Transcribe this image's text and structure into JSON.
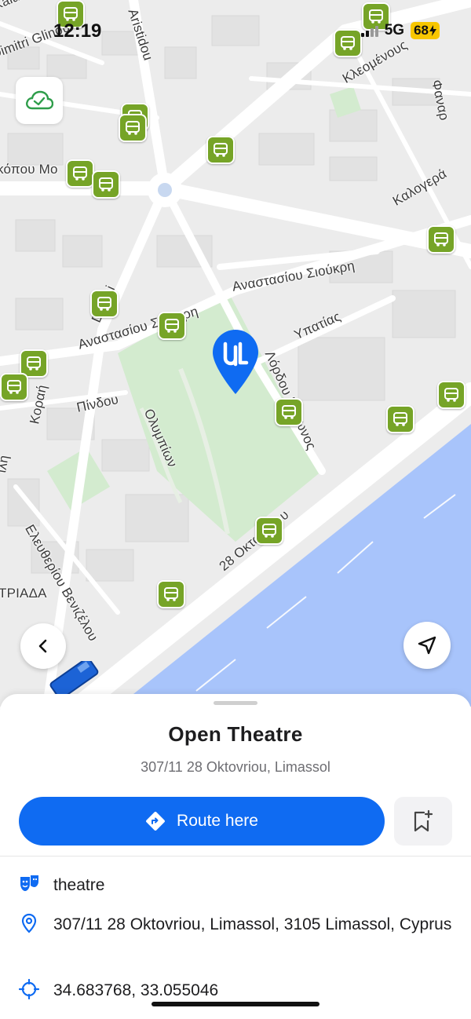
{
  "status_bar": {
    "time": "12:19",
    "network": "5G",
    "battery": "68"
  },
  "map": {
    "street_labels": [
      {
        "text": "Kalama"
      },
      {
        "text": "Dimitri Glinou"
      },
      {
        "text": "Aristidou"
      },
      {
        "text": "Κλεομένους"
      },
      {
        "text": "Φαναρ"
      },
      {
        "text": "κόπου Μο"
      },
      {
        "text": "Καλογερά"
      },
      {
        "text": "Αναστασίου Σιούκρη"
      },
      {
        "text": "Digeni"
      },
      {
        "text": "Αναστασίου Σιούκρη"
      },
      {
        "text": "Υπατίας"
      },
      {
        "text": "Λόρδου Βύρωνος"
      },
      {
        "text": "Κοραή"
      },
      {
        "text": "Πίνδου"
      },
      {
        "text": "Ολυμπίων"
      },
      {
        "text": "28 Οκτωβρίου"
      },
      {
        "text": "Ελευθερίου Βενιζέλου"
      },
      {
        "text": "ΤΡΙΑΔΑ"
      },
      {
        "text": "ίλη"
      }
    ],
    "bus_stop_icon": "bus-stop-icon"
  },
  "colors": {
    "accent": "#0f6bf2",
    "bus_stop": "#76a427",
    "sea": "#a8c4fb",
    "park": "#d3ebcf"
  },
  "place": {
    "name": "Open Theatre",
    "short_address": "307/11 28 Oktovriou, Limassol",
    "route_label": "Route here",
    "category": "theatre",
    "full_address": "307/11 28 Oktovriou, Limassol, 3105 Limassol, Cyprus",
    "coordinates": "34.683768, 33.055046"
  }
}
